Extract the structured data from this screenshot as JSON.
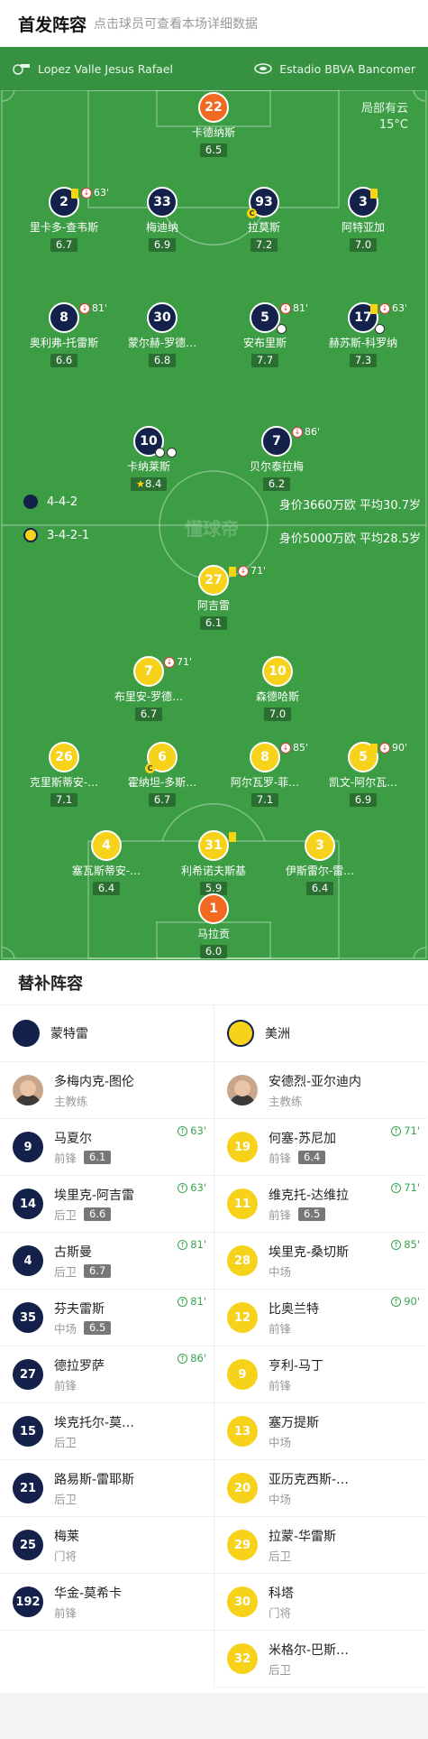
{
  "header": {
    "title": "首发阵容",
    "subtitle": "点击球员可查看本场详细数据"
  },
  "pitch_bar": {
    "referee": "Lopez Valle Jesus Rafael",
    "stadium": "Estadio BBVA Bancomer"
  },
  "weather": {
    "condition": "局部有云",
    "temp": "15°C"
  },
  "watermark": "懂球帝",
  "home": {
    "formation": "4-4-2",
    "value_text": "身价3660万欧  平均30.7岁",
    "players": [
      {
        "no": "22",
        "name": "卡德纳斯",
        "rating": "6.5"
      },
      {
        "no": "2",
        "name": "里卡多-查韦斯",
        "rating": "6.7",
        "sub_min": "63'"
      },
      {
        "no": "33",
        "name": "梅迪纳",
        "rating": "6.9"
      },
      {
        "no": "93",
        "name": "拉莫斯",
        "rating": "7.2"
      },
      {
        "no": "3",
        "name": "阿特亚加",
        "rating": "7.0"
      },
      {
        "no": "8",
        "name": "奥利弗-托雷斯",
        "rating": "6.6",
        "sub_min": "81'"
      },
      {
        "no": "30",
        "name": "蒙尔赫-罗德…",
        "rating": "6.8"
      },
      {
        "no": "5",
        "name": "安布里斯",
        "rating": "7.7",
        "sub_min": "81'"
      },
      {
        "no": "17",
        "name": "赫苏斯-科罗纳",
        "rating": "7.3",
        "sub_min": "63'"
      },
      {
        "no": "10",
        "name": "卡纳莱斯",
        "rating": "8.4"
      },
      {
        "no": "7",
        "name": "贝尔泰拉梅",
        "rating": "6.2",
        "sub_min": "86'"
      }
    ]
  },
  "away": {
    "formation": "3-4-2-1",
    "value_text": "身价5000万欧  平均28.5岁",
    "players": [
      {
        "no": "27",
        "name": "阿吉雷",
        "rating": "6.1",
        "sub_min": "71'"
      },
      {
        "no": "7",
        "name": "布里安-罗德…",
        "rating": "6.7",
        "sub_min": "71'"
      },
      {
        "no": "10",
        "name": "森德哈斯",
        "rating": "7.0"
      },
      {
        "no": "26",
        "name": "克里斯蒂安-…",
        "rating": "7.1"
      },
      {
        "no": "6",
        "name": "霍纳坦-多斯…",
        "rating": "6.7"
      },
      {
        "no": "8",
        "name": "阿尔瓦罗-菲…",
        "rating": "7.1",
        "sub_min": "85'"
      },
      {
        "no": "5",
        "name": "凯文-阿尔瓦…",
        "rating": "6.9",
        "sub_min": "90'"
      },
      {
        "no": "4",
        "name": "塞瓦斯蒂安-…",
        "rating": "6.4"
      },
      {
        "no": "31",
        "name": "利希诺夫斯基",
        "rating": "5.9"
      },
      {
        "no": "3",
        "name": "伊斯雷尔-雷…",
        "rating": "6.4"
      },
      {
        "no": "1",
        "name": "马拉贡",
        "rating": "6.0"
      }
    ]
  },
  "subs": {
    "title": "替补阵容",
    "home_team": "蒙特雷",
    "away_team": "美洲",
    "home_coach": {
      "name": "多梅内克-图伦",
      "role": "主教练"
    },
    "away_coach": {
      "name": "安德烈-亚尔迪内",
      "role": "主教练"
    },
    "home_list": [
      {
        "no": "9",
        "name": "马夏尔",
        "pos": "前锋",
        "rating": "6.1",
        "min": "63'"
      },
      {
        "no": "14",
        "name": "埃里克-阿吉雷",
        "pos": "后卫",
        "rating": "6.6",
        "min": "63'"
      },
      {
        "no": "4",
        "name": "古斯曼",
        "pos": "后卫",
        "rating": "6.7",
        "min": "81'"
      },
      {
        "no": "35",
        "name": "芬夫雷斯",
        "pos": "中场",
        "rating": "6.5",
        "min": "81'"
      },
      {
        "no": "27",
        "name": "德拉罗萨",
        "pos": "前锋",
        "min": "86'"
      },
      {
        "no": "15",
        "name": "埃克托尔-莫…",
        "pos": "后卫"
      },
      {
        "no": "21",
        "name": "路易斯-雷耶斯",
        "pos": "后卫"
      },
      {
        "no": "25",
        "name": "梅莱",
        "pos": "门将"
      },
      {
        "no": "192",
        "name": "华金-莫希卡",
        "pos": "前锋"
      }
    ],
    "away_list": [
      {
        "no": "19",
        "name": "何塞-苏尼加",
        "pos": "前锋",
        "rating": "6.4",
        "min": "71'"
      },
      {
        "no": "11",
        "name": "维克托-达维拉",
        "pos": "前锋",
        "rating": "6.5",
        "min": "71'"
      },
      {
        "no": "28",
        "name": "埃里克-桑切斯",
        "pos": "中场",
        "min": "85'"
      },
      {
        "no": "12",
        "name": "比奥兰特",
        "pos": "前锋",
        "min": "90'"
      },
      {
        "no": "9",
        "name": "亨利-马丁",
        "pos": "前锋"
      },
      {
        "no": "13",
        "name": "塞万提斯",
        "pos": "中场"
      },
      {
        "no": "20",
        "name": "亚历克西斯-…",
        "pos": "中场"
      },
      {
        "no": "29",
        "name": "拉蒙-华雷斯",
        "pos": "后卫"
      },
      {
        "no": "30",
        "name": "科塔",
        "pos": "门将"
      },
      {
        "no": "32",
        "name": "米格尔-巴斯…",
        "pos": "后卫"
      }
    ]
  },
  "colors": {
    "pitch": "#3c9d45",
    "home": "#13214b",
    "away": "#f7d21a",
    "gk": "#f26a21"
  }
}
